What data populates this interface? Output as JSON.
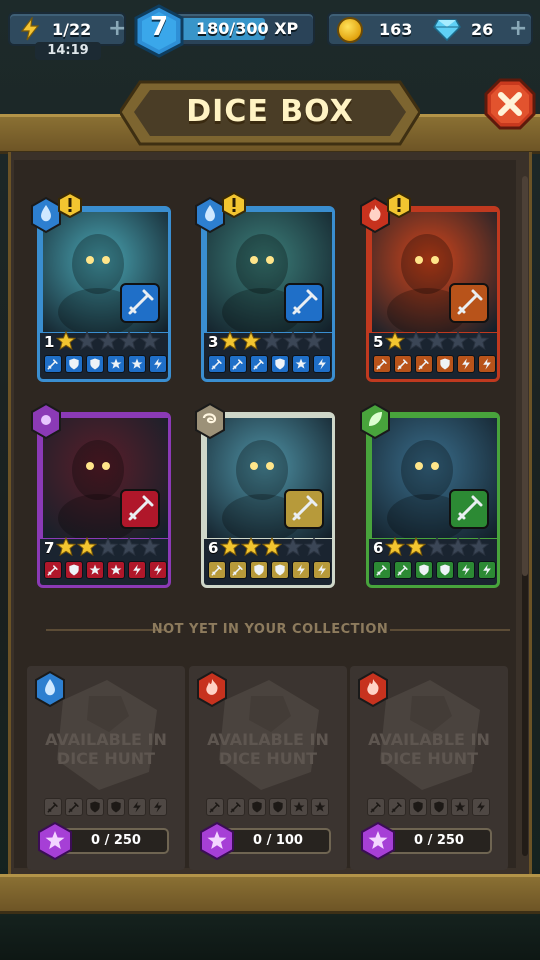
{
  "topbar": {
    "energy": "1/22",
    "energy_timer": "14:19",
    "level": "7",
    "xp": "180/300 XP",
    "xp_progress": 0.6,
    "coins": "163",
    "gems": "26"
  },
  "header": {
    "title": "DICE BOX"
  },
  "owned_dice": [
    {
      "level": "1",
      "stars": 1,
      "element": "water",
      "warning": true,
      "border": "#3a8ed0",
      "art": "#4aa6b4",
      "faces": [
        "sword",
        "shield",
        "shield",
        "star",
        "star",
        "bolt"
      ],
      "face_color": "#1f6fc8"
    },
    {
      "level": "3",
      "stars": 2,
      "element": "water",
      "warning": true,
      "border": "#3a8ed0",
      "art": "#3c7f7a",
      "faces": [
        "sword",
        "sword",
        "sword",
        "shield",
        "star",
        "bolt"
      ],
      "face_color": "#1f6fc8"
    },
    {
      "level": "5",
      "stars": 1,
      "element": "fire",
      "warning": true,
      "border": "#c0391f",
      "art": "#d4451b",
      "faces": [
        "sword",
        "sword",
        "sword",
        "shield",
        "bolt",
        "bolt"
      ],
      "face_color": "#b8531a"
    },
    {
      "level": "7",
      "stars": 2,
      "element": "shadow",
      "warning": false,
      "border": "#8b3ab6",
      "art": "#5a1e2a",
      "faces": [
        "sword",
        "shield",
        "star",
        "star",
        "bolt",
        "bolt"
      ],
      "face_color": "#b0172a"
    },
    {
      "level": "6",
      "stars": 3,
      "element": "air",
      "warning": false,
      "border": "#cfd7c9",
      "art": "#4f93a6",
      "faces": [
        "sword",
        "sword",
        "shield",
        "shield",
        "bolt",
        "bolt"
      ],
      "face_color": "#b79a3a"
    },
    {
      "level": "6",
      "stars": 2,
      "element": "nature",
      "warning": false,
      "border": "#48a43c",
      "art": "#3a6e8c",
      "faces": [
        "sword",
        "sword",
        "shield",
        "shield",
        "bolt",
        "bolt"
      ],
      "face_color": "#2c8a34"
    }
  ],
  "collection": {
    "label": "NOT YET IN YOUR COLLECTION",
    "items": [
      {
        "element": "water",
        "text": "AVAILABLE IN\nDICE HUNT",
        "progress": "0 / 250",
        "faces": [
          "sword",
          "sword",
          "shield",
          "shield",
          "bolt",
          "bolt"
        ]
      },
      {
        "element": "fire",
        "text": "AVAILABLE IN\nDICE HUNT",
        "progress": "0 / 100",
        "faces": [
          "sword",
          "sword",
          "shield",
          "shield",
          "star",
          "star"
        ]
      },
      {
        "element": "fire",
        "text": "AVAILABLE IN\nDICE HUNT",
        "progress": "0 / 250",
        "faces": [
          "sword",
          "sword",
          "shield",
          "shield",
          "star",
          "bolt"
        ]
      }
    ]
  },
  "colors": {
    "water": "#2d7fd0",
    "fire": "#c7321e",
    "shadow": "#8b3ab6",
    "air": "#9c9178",
    "nature": "#48a43c",
    "frame": "#8a7033"
  }
}
